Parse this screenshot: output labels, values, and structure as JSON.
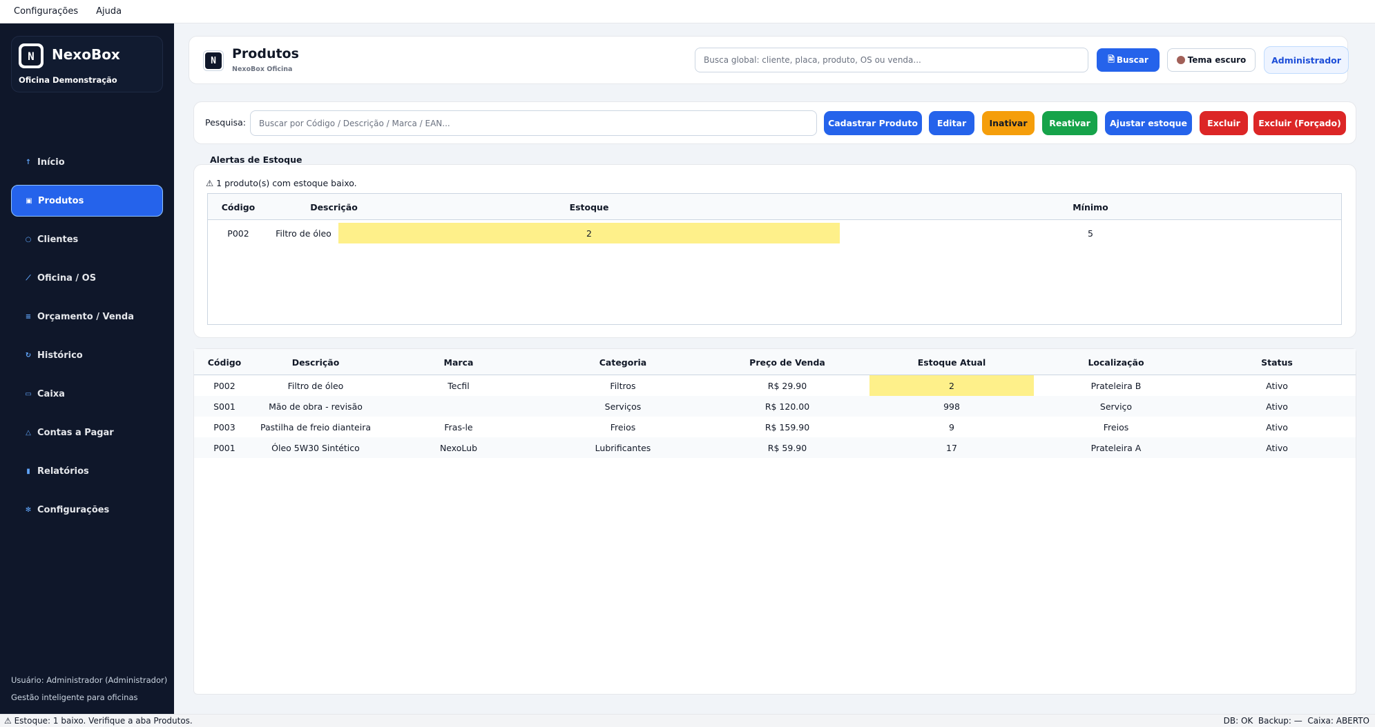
{
  "menubar": {
    "items": [
      "Configurações",
      "Ajuda"
    ]
  },
  "brand": {
    "logo_text": "N",
    "name": "NexoBox",
    "subtitle": "Oficina Demonstração"
  },
  "sidebar": {
    "items": [
      {
        "label": "Início",
        "icon": "arrow-up-icon",
        "glyph": "↑",
        "active": false
      },
      {
        "label": "Produtos",
        "icon": "box-icon",
        "glyph": "▣",
        "active": true
      },
      {
        "label": "Clientes",
        "icon": "user-icon",
        "glyph": "○",
        "active": false
      },
      {
        "label": "Oficina / OS",
        "icon": "wrench-icon",
        "glyph": "⟋",
        "active": false
      },
      {
        "label": "Orçamento / Venda",
        "icon": "list-icon",
        "glyph": "≡",
        "active": false
      },
      {
        "label": "Histórico",
        "icon": "history-icon",
        "glyph": "↻",
        "active": false
      },
      {
        "label": "Caixa",
        "icon": "cash-icon",
        "glyph": "▭",
        "active": false
      },
      {
        "label": "Contas a Pagar",
        "icon": "warning-icon",
        "glyph": "△",
        "active": false
      },
      {
        "label": "Relatórios",
        "icon": "chart-icon",
        "glyph": "▮",
        "active": false
      },
      {
        "label": "Configurações",
        "icon": "gear-icon",
        "glyph": "✻",
        "active": false
      }
    ],
    "footer_user": "Usuário: Administrador (Administrador)",
    "footer_tagline": "Gestão inteligente para oficinas"
  },
  "header": {
    "title": "Produtos",
    "subtitle": "NexoBox Oficina",
    "search_placeholder": "Busca global: cliente, placa, produto, OS ou venda...",
    "search_button": "Buscar",
    "theme_button": "Tema escuro",
    "admin_button": "Administrador"
  },
  "toolbar": {
    "search_label": "Pesquisa:",
    "search_placeholder": "Buscar por Código / Descrição / Marca / EAN...",
    "buttons": {
      "cadastrar": "Cadastrar Produto",
      "editar": "Editar",
      "inativar": "Inativar",
      "reativar": "Reativar",
      "ajustar": "Ajustar estoque",
      "excluir": "Excluir",
      "excluir_forcado": "Excluir (Forçado)"
    },
    "colors": {
      "primary": "#2563eb",
      "warning": "#f59e0b",
      "success": "#16a34a",
      "danger": "#dc2626"
    }
  },
  "alerts": {
    "title": "Alertas de Estoque",
    "message": "⚠ 1 produto(s) com estoque baixo.",
    "columns": [
      "Código",
      "Descrição",
      "Estoque",
      "Mínimo"
    ],
    "rows": [
      {
        "codigo": "P002",
        "descricao": "Filtro de óleo",
        "estoque": "2",
        "minimo": "5"
      }
    ]
  },
  "products": {
    "columns": [
      "Código",
      "Descrição",
      "Marca",
      "Categoria",
      "Preço de Venda",
      "Estoque Atual",
      "Localização",
      "Status"
    ],
    "rows": [
      {
        "codigo": "P002",
        "descricao": "Filtro de óleo",
        "marca": "Tecfil",
        "categoria": "Filtros",
        "preco": "R$ 29.90",
        "estoque": "2",
        "localizacao": "Prateleira B",
        "status": "Ativo",
        "low_stock": true
      },
      {
        "codigo": "S001",
        "descricao": "Mão de obra - revisão",
        "marca": "",
        "categoria": "Serviços",
        "preco": "R$ 120.00",
        "estoque": "998",
        "localizacao": "Serviço",
        "status": "Ativo",
        "low_stock": false
      },
      {
        "codigo": "P003",
        "descricao": "Pastilha de freio dianteira",
        "marca": "Fras-le",
        "categoria": "Freios",
        "preco": "R$ 159.90",
        "estoque": "9",
        "localizacao": "Freios",
        "status": "Ativo",
        "low_stock": false
      },
      {
        "codigo": "P001",
        "descricao": "Óleo 5W30 Sintético",
        "marca": "NexoLub",
        "categoria": "Lubrificantes",
        "preco": "R$ 59.90",
        "estoque": "17",
        "localizacao": "Prateleira A",
        "status": "Ativo",
        "low_stock": false
      }
    ],
    "highlight_color": "#fef08a"
  },
  "statusbar": {
    "left": "⚠ Estoque: 1 baixo. Verifique a aba Produtos.",
    "right": "DB: OK  Backup: —  Caixa: ABERTO"
  }
}
